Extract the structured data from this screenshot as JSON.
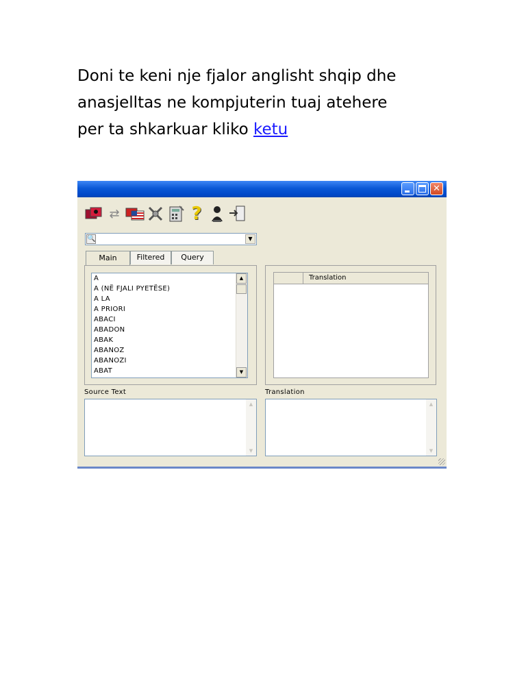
{
  "document": {
    "text_lines": [
      "Doni te keni nje fjalor  anglisht shqip dhe",
      "anasjelltas ne kompjuterin tuaj atehere",
      "per ta shkarkuar kliko "
    ],
    "link_text": "ketu"
  },
  "app": {
    "window_buttons": [
      "minimize",
      "maximize",
      "close"
    ],
    "toolbar": [
      {
        "icon": "albanian-flag-icon"
      },
      {
        "icon": "swap-arrows-icon"
      },
      {
        "icon": "us-flag-icon"
      },
      {
        "icon": "tools-icon"
      },
      {
        "icon": "calculator-icon"
      },
      {
        "icon": "help-icon"
      },
      {
        "icon": "user-icon"
      },
      {
        "icon": "exit-icon"
      }
    ],
    "search": {
      "value": ""
    },
    "tabs": [
      "Main",
      "Filtered",
      "Query"
    ],
    "active_tab": "Main",
    "word_list": [
      "A",
      "A (NË FJALI PYETËSE)",
      "A LA",
      "A PRIORI",
      "ABACI",
      "ABADON",
      "ABAK",
      "ABANOZ",
      "ABANOZI",
      "ABAT"
    ],
    "grid_header": "Translation",
    "source_label": "Source Text",
    "translation_label": "Translation"
  }
}
